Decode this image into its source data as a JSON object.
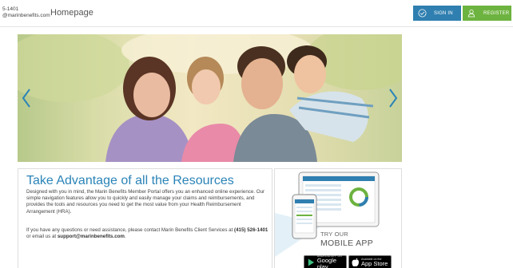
{
  "header": {
    "contact_line1": "5-1401",
    "contact_line2": "@marinbenefits.com",
    "page_title": "Homepage",
    "signin_label": "SIGN IN",
    "register_label": "REGISTER"
  },
  "colors": {
    "signin": "#2f7fb0",
    "register": "#6db33f",
    "headline": "#2a84b8"
  },
  "hero": {
    "prev_icon": "chevron-left-icon",
    "next_icon": "chevron-right-icon"
  },
  "intro": {
    "headline_pre": "Take ",
    "headline_mid": "Advantage",
    "headline_post": " of all the Resources",
    "body": "Designed with you in mind, the Marin Benefits Member Portal offers you an enhanced online experience. Our simple navigation features allow you to quickly and easily manage your claims and reimbursements, and provides the tools and resources you need to get the most value from your Health Reimbursement Arrangement (HRA).",
    "assist_pre": "If you have any questions or need assistance, please contact Marin Benefits Client Services at ",
    "assist_phone": "(415) 526-1401",
    "assist_mid": " or email us at ",
    "assist_email": "support@marinbenefits.com",
    "assist_post": "."
  },
  "mobile": {
    "try_label": "TRY OUR",
    "app_label": "MOBILE APP",
    "google_small": "ANDROID APP ON",
    "google_big": "Google play",
    "apple_small": "Available on the",
    "apple_big": "App Store"
  }
}
